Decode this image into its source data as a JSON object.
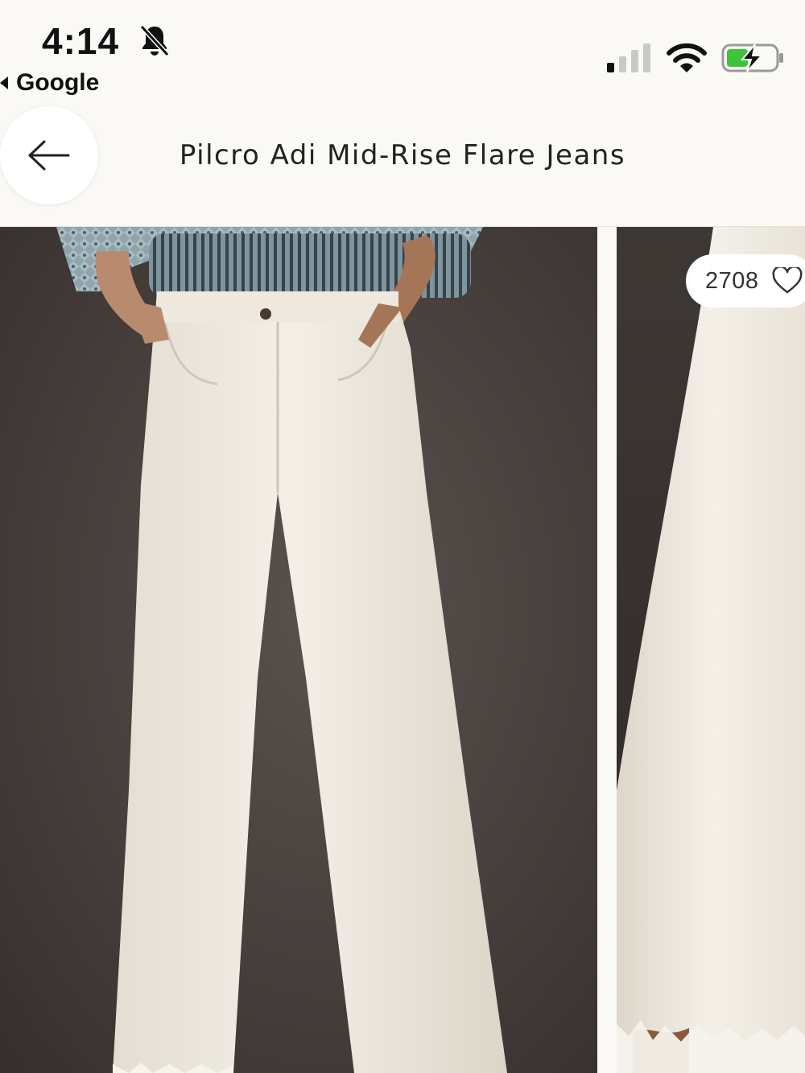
{
  "status_bar": {
    "time": "4:14",
    "back_app_label": "Google",
    "icons": [
      "bell-slash-icon",
      "cellular-signal-icon",
      "wifi-icon",
      "battery-charging-icon"
    ]
  },
  "header": {
    "back_icon": "arrow-left-icon",
    "title": "Pilcro Adi Mid-Rise Flare Jeans"
  },
  "gallery": {
    "images": [
      {
        "alt": "Model wearing white flare jeans with knit sweater"
      },
      {
        "alt": "Close-up of white flare jeans frayed hem"
      }
    ],
    "like_count": "2708",
    "like_icon": "heart-outline-icon"
  },
  "colors": {
    "background": "#fbf9f6",
    "photo_backdrop": "#4a423f",
    "jeans": "#efe9df",
    "battery_green": "#3ec43a"
  }
}
